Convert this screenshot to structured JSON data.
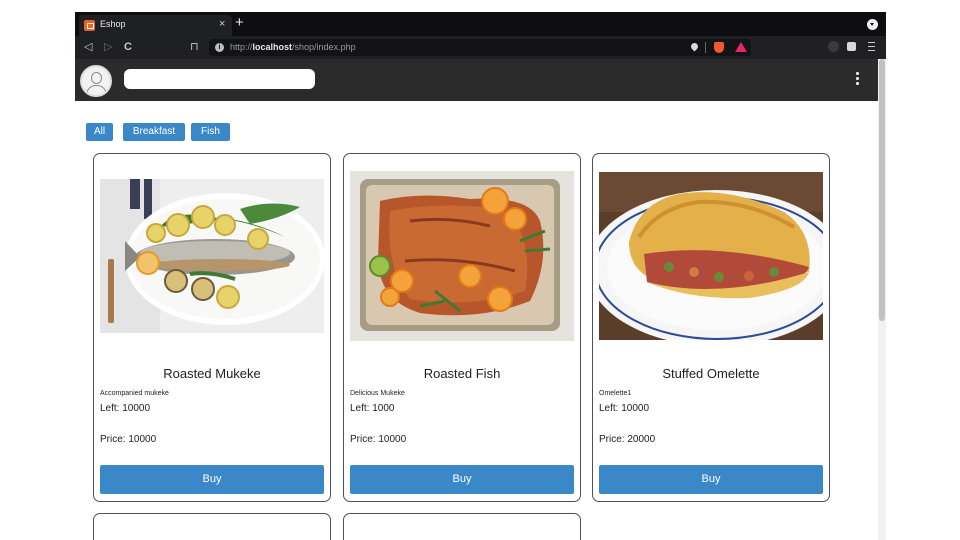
{
  "browser": {
    "tab": {
      "title": "Eshop",
      "close": "×"
    },
    "new_tab": "+",
    "nav": {
      "back": "◁",
      "forward": "▷",
      "reload": "C",
      "bookmark": "⊓"
    },
    "url": {
      "prefix": "http://",
      "host": "localhost",
      "path": "/shop/index.php"
    }
  },
  "app": {
    "search": {
      "value": "",
      "placeholder": ""
    },
    "filters": [
      {
        "label": "All"
      },
      {
        "label": "Breakfast"
      },
      {
        "label": "Fish"
      }
    ],
    "products": [
      {
        "name": "Roasted Mukeke",
        "description": "Accompanied mukeke",
        "left": "Left: 10000",
        "price": "Price: 10000",
        "buy_label": "Buy",
        "image": "roasted-fish-with-lemons"
      },
      {
        "name": "Roasted Fish",
        "description": "Delicious Mukeke",
        "left": "Left: 1000",
        "price": "Price: 10000",
        "buy_label": "Buy",
        "image": "roasted-fish-tray"
      },
      {
        "name": "Stuffed Omelette",
        "description": "Omelette1",
        "left": "Left: 10000",
        "price": "Price: 20000",
        "buy_label": "Buy",
        "image": "stuffed-omelette-plate"
      }
    ]
  },
  "colors": {
    "accent": "#3a88c8",
    "appbar": "#2b2b2b",
    "brave_orange": "#f15a2b"
  }
}
